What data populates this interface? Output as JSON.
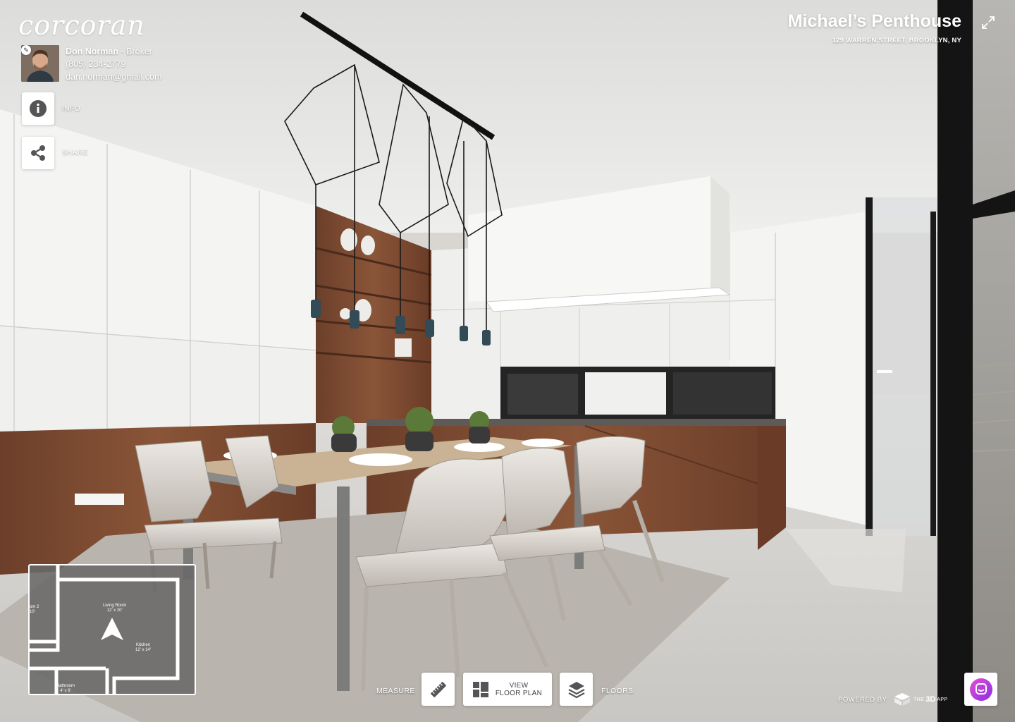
{
  "brand": {
    "logo_text": "corcoran"
  },
  "agent": {
    "name": "Don Norman",
    "role": "- Broker",
    "phone": "(805) 234-2779",
    "email": "dan.norman@gmail.com"
  },
  "side_actions": {
    "info_label": "INFO",
    "share_label": "SHARE"
  },
  "listing": {
    "title": "Michael’s Penthouse",
    "address": "129 WARREN STREET, BROOKLYN, NY"
  },
  "minimap": {
    "rooms": [
      {
        "name": "Living Room",
        "size": "12' x 20'"
      },
      {
        "name": "Kitchen",
        "size": "12' x 14'"
      },
      {
        "name": "Bathroom",
        "size": "4' x 6'"
      },
      {
        "name": "om 2",
        "size": "10'"
      }
    ]
  },
  "toolbar": {
    "measure_label": "MEASURE",
    "floorplan_line1": "VIEW",
    "floorplan_line2": "FLOOR PLAN",
    "floors_label": "FLOORS"
  },
  "footer": {
    "powered_by": "POWERED BY",
    "logo_the": "THE",
    "logo_3d": "3D",
    "logo_app": "APP"
  },
  "colors": {
    "chat_accent": "#b82fe0",
    "wood": "#7a4a32",
    "ui_white": "#ffffff"
  },
  "icons": [
    "edit-icon",
    "info-icon",
    "share-icon",
    "expand-icon",
    "location-arrow-icon",
    "ruler-icon",
    "floor-plan-icon",
    "layers-icon",
    "the3d-logo-icon",
    "chat-icon"
  ]
}
